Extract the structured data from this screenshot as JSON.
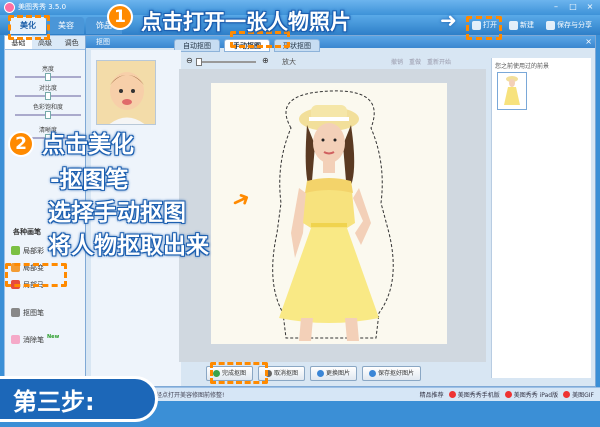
{
  "app": {
    "title": "美图秀秀 3.5.0"
  },
  "top_tabs": [
    "美化",
    "美容",
    "饰品"
  ],
  "toolbar": {
    "open": "打开",
    "new": "新建",
    "save": "保存与分享"
  },
  "left_tabs": [
    "基础",
    "高级",
    "调色"
  ],
  "sliders": [
    "亮度",
    "对比度",
    "色彩饱和度",
    "清晰度"
  ],
  "brush_section": "各种画笔",
  "brushes": [
    "局部彩",
    "局部变",
    "局部马",
    "抠图笔",
    "消除笔"
  ],
  "brush_badge": "New",
  "editor": {
    "window_title": "抠图",
    "tabs": [
      "自动抠图",
      "手动抠图",
      "形状抠图"
    ],
    "zoom_label": "放大",
    "undo_labels": [
      "撤销",
      "重做",
      "重新开始"
    ],
    "history_label": "您之前使用过的前景"
  },
  "buttons": [
    "完成抠图",
    "取消抠图",
    "更换图片",
    "保存抠好图片"
  ],
  "status": {
    "left_text": "已经点打开美容修图前修整!",
    "recommend": "精品推荐",
    "links": [
      "美图秀秀手机版",
      "美图秀秀 iPad版",
      "美图GIF"
    ]
  },
  "annotations": {
    "step1_num": "1",
    "step1_text": "点击打开一张人物照片",
    "step2_num": "2",
    "step2_lines": [
      "点击美化",
      "-抠图笔",
      "选择手动抠图",
      "将人物抠取出来"
    ],
    "step_banner": "第三步:"
  },
  "colors": {
    "accent": "#ff8a00",
    "brand": "#1c67b8"
  }
}
